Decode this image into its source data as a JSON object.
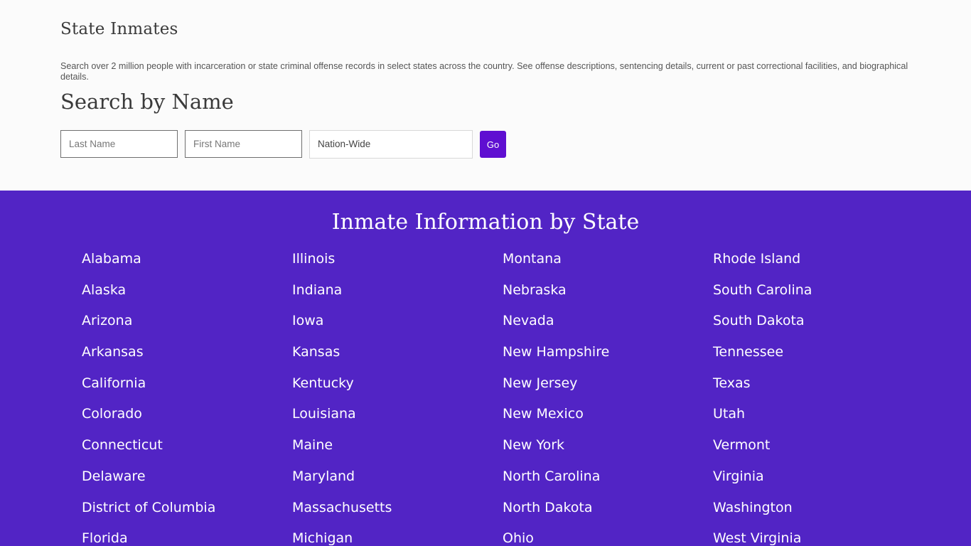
{
  "intro": {
    "title": "State Inmates",
    "description": "Search over 2 million people with incarceration or state criminal offense records in select states across the country. See offense descriptions, sentencing details, current or past correctional facilities, and biographical details."
  },
  "search": {
    "title": "Search by Name",
    "last_name_placeholder": "Last Name",
    "first_name_placeholder": "First Name",
    "state_selected": "Nation-Wide",
    "go_label": "Go"
  },
  "states_section": {
    "title": "Inmate Information by State",
    "columns": [
      [
        "Alabama",
        "Alaska",
        "Arizona",
        "Arkansas",
        "California",
        "Colorado",
        "Connecticut",
        "Delaware",
        "District of Columbia",
        "Florida"
      ],
      [
        "Illinois",
        "Indiana",
        "Iowa",
        "Kansas",
        "Kentucky",
        "Louisiana",
        "Maine",
        "Maryland",
        "Massachusetts",
        "Michigan"
      ],
      [
        "Montana",
        "Nebraska",
        "Nevada",
        "New Hampshire",
        "New Jersey",
        "New Mexico",
        "New York",
        "North Carolina",
        "North Dakota",
        "Ohio"
      ],
      [
        "Rhode Island",
        "South Carolina",
        "South Dakota",
        "Tennessee",
        "Texas",
        "Utah",
        "Vermont",
        "Virginia",
        "Washington",
        "West Virginia"
      ]
    ]
  },
  "colors": {
    "accent_button": "#5f0fd1",
    "states_background": "#5224c5"
  }
}
